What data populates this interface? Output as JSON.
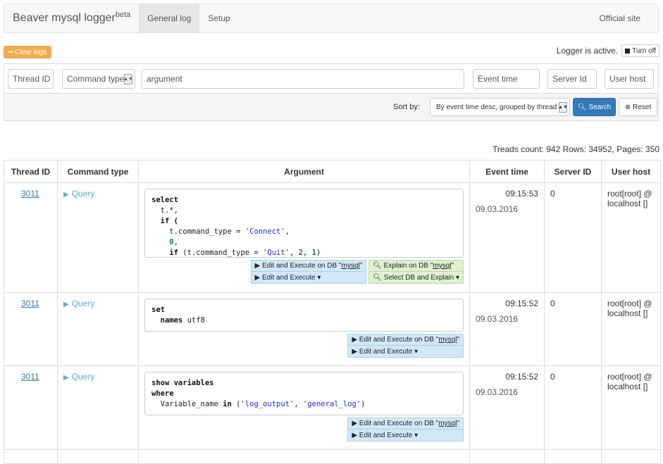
{
  "navbar": {
    "brand": "Beaver mysql logger",
    "brand_sup": "beta",
    "tabs": [
      {
        "label": "General log"
      },
      {
        "label": "Setup"
      }
    ],
    "official_site": "Official site"
  },
  "status": {
    "clear_logs": "Clear logs",
    "logger_active": "Logger is active.",
    "turn_off": "Turn off"
  },
  "filters": {
    "thread_id": "Thread ID",
    "command_type": "Command type",
    "argument": "argument",
    "event_time": "Event time",
    "server_id": "Server Id",
    "user_host": "User host",
    "sort_by_label": "Sort by:",
    "sort_value": "By event time desc, grouped by thread",
    "search": "Search",
    "reset": "Reset"
  },
  "counts": "Treads count: 942 Rows: 34952, Pages: 350",
  "table": {
    "headers": [
      "Thread ID",
      "Command type",
      "Argument",
      "Event time",
      "Server ID",
      "User host"
    ],
    "rows": [
      {
        "thread_id": "3011",
        "command_type": "Query",
        "time": "09:15:53",
        "date": "09.03.2016",
        "server_id": "0",
        "user_host": "root[root] @ localhost []"
      },
      {
        "thread_id": "3011",
        "command_type": "Query",
        "time": "09:15:52",
        "date": "09.03.2016",
        "server_id": "0",
        "user_host": "root[root] @ localhost []"
      },
      {
        "thread_id": "3011",
        "command_type": "Query",
        "time": "09:15:52",
        "date": "09.03.2016",
        "server_id": "0",
        "user_host": "root[root] @ localhost []"
      }
    ]
  },
  "code": {
    "row1": {
      "l1": "select",
      "l2": "  t.*,",
      "l3": "  if (",
      "l4a": "    t.command_type = ",
      "l4b": "'Connect'",
      "l4c": ",",
      "l5a": "    ",
      "l5b": "0",
      "l5c": ",",
      "l6a": "    if",
      "l6b": " (t.command_type = ",
      "l6c": "'Quit'",
      "l6d": ", ",
      "l6e": "2",
      "l6f": ", ",
      "l6g": "1",
      "l6h": ")"
    },
    "row2": {
      "l1": "set",
      "l2a": "  names",
      "l2b": " utf8"
    },
    "row3": {
      "l1": "show variables",
      "l2": "where",
      "l3a": "  Variable_name ",
      "l3b": "in",
      "l3c": " (",
      "l3d": "'log_output'",
      "l3e": ", ",
      "l3f": "'general_log'",
      "l3g": ")"
    }
  },
  "actions": {
    "edit_exec_db_prefix": "Edit and Execute on DB \"",
    "db_name": "mysql",
    "quote": "\"",
    "edit_exec": "Edit and Execute",
    "explain_db_prefix": "Explain on DB \"",
    "select_db_explain": "Select DB and Explain"
  }
}
